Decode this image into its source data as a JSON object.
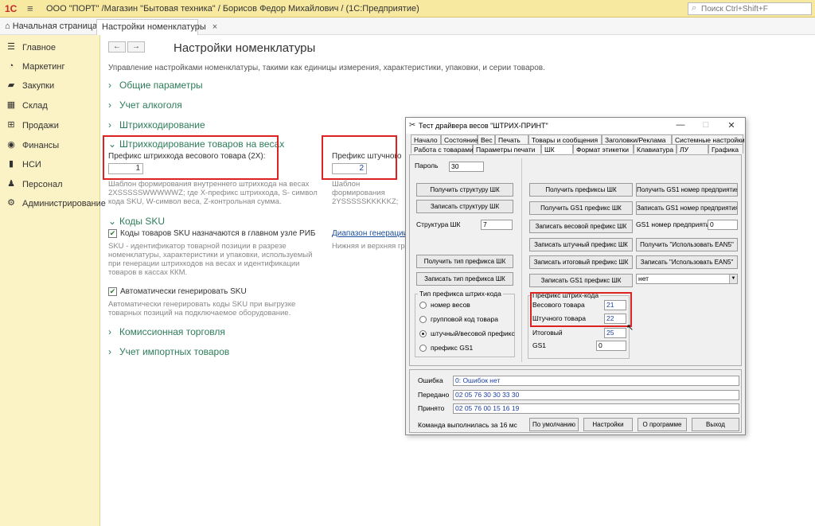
{
  "topbar": {
    "logo": "1С",
    "title": "ООО \"ПОРТ\" /Магазин \"Бытовая техника\" / Борисов Федор Михайлович / (1С:Предприятие)",
    "search_placeholder": "Поиск Ctrl+Shift+F"
  },
  "tabs": {
    "home": "Начальная страница",
    "active": "Настройки номенклатуры",
    "close": "×"
  },
  "sidebar": {
    "items": [
      {
        "label": "Главное"
      },
      {
        "label": "Маркетинг"
      },
      {
        "label": "Закупки"
      },
      {
        "label": "Склад"
      },
      {
        "label": "Продажи"
      },
      {
        "label": "Финансы"
      },
      {
        "label": "НСИ"
      },
      {
        "label": "Персонал"
      },
      {
        "label": "Администрирование"
      }
    ]
  },
  "main": {
    "back": "←",
    "forward": "→",
    "title": "Настройки номенклатуры",
    "description": "Управление настройками номенклатуры, такими как единицы измерения, характеристики, упаковки, и серии товаров.",
    "sections": {
      "general": "Общие параметры",
      "alcohol": "Учет алкоголя",
      "barcoding": "Штрихкодирование",
      "scales": "Штрихкодирование товаров на весах",
      "sku": "Коды SKU",
      "commission": "Комиссионная торговля",
      "imported": "Учет импортных товаров"
    },
    "weight_prefix_label": "Префикс штрихкода весового товара (2Х):",
    "weight_prefix_value": "1",
    "weight_template_hint": "Шаблон формирования внутреннего штрихкода на весах 2XSSSSSWWWWWZ; где X-префикс штрихкода, S- символ кода SKU, W-символ веса, Z-контрольная сумма.",
    "piece_prefix_label": "Префикс штучного",
    "piece_prefix_value": "2",
    "piece_template_hint": "Шаблон формирования 2YSSSSSKKKKKZ; где кода SKU, K-символ",
    "sku_check_label": "Коды товаров SKU назначаются в главном узле РИБ",
    "sku_hint": "SKU - идентификатор товарной позиции в разрезе номенклатуры, характеристики и упаковки, используемый при генерации штрихкодов на весах и идентификации товаров в кассах ККМ.",
    "sku_range_link": "Диапазон генерации S",
    "sku_range_hint": "Нижняя и верхняя гра",
    "auto_check_label": "Автоматически генерировать SKU",
    "auto_hint": "Автоматически генерировать коды SKU при выгрузке товарных позиций на подключаемое оборудование."
  },
  "dialog": {
    "title": "Тест драйвера весов \"ШТРИХ-ПРИНТ\"",
    "min": "—",
    "max": "□",
    "close": "✕",
    "tabs_row1": [
      "Начало",
      "Состояние",
      "Вес",
      "Печать",
      "Товары и сообщения",
      "Заголовки/Реклама",
      "Системные настройки"
    ],
    "tabs_row2": [
      "Работа с товарами",
      "Параметры печати",
      "ШК",
      "Формат этикетки",
      "Клавиатура",
      "ЛУ",
      "Графика"
    ],
    "password_label": "Пароль",
    "password_value": "30",
    "btn_get_struct": "Получить структуру ШК",
    "btn_set_struct": "Записать структуру ШК",
    "struct_label": "Структура ШК",
    "struct_value": "7",
    "btn_get_type": "Получить тип префикса ШК",
    "btn_set_type": "Записать тип префикса ШК",
    "type_group": "Тип префикса штрих-кода",
    "radios": [
      "номер весов",
      "групповой код товара",
      "штучный/весовой префикс",
      "префикс GS1"
    ],
    "btn_get_prefixes": "Получить префиксы ШК",
    "btn_get_gs1_prefix": "Получить GS1 префикс ШК",
    "btn_set_weight_prefix": "Записать весовой префикс ШК",
    "btn_set_piece_prefix": "Записать штучный префикс ШК",
    "btn_set_total_prefix": "Записать итоговый префикс ШК",
    "btn_set_gs1_prefix": "Записать GS1 префикс ШК",
    "btn_get_gs1_num": "Получить GS1 номер предприятия",
    "btn_set_gs1_num": "Записать GS1 номер предприятия",
    "gs1_num_label": "GS1 номер предприятия",
    "gs1_num_value": "0",
    "btn_get_ean5": "Получить \"Использовать EAN5\"",
    "btn_set_ean5": "Записать \"Использовать EAN5\"",
    "ean5_select": "нет",
    "prefix_group": "Префикс штрих-кода",
    "weight_label": "Весового товара",
    "weight_value": "21",
    "piece_label": "Штучного товара",
    "piece_value": "22",
    "total_label": "Итоговый",
    "total_value": "25",
    "gs1_label": "GS1",
    "gs1_value": "0",
    "error_label": "Ошибка",
    "error_value": "0: Ошибок нет",
    "sent_label": "Передано",
    "sent_value": "02 05 76 30 30 33 30",
    "recv_label": "Принято",
    "recv_value": "02 05 76 00 15 16 19",
    "status": "Команда выполнилась за 16 мс",
    "btn_default": "По умолчанию",
    "btn_settings": "Настройки",
    "btn_about": "О программе",
    "btn_exit": "Выход"
  },
  "colors": {
    "topbar": "#f7e9a0",
    "sidebar": "#fbf2c5",
    "section_green": "#2e7d5a",
    "highlight_red": "#dd2222"
  }
}
